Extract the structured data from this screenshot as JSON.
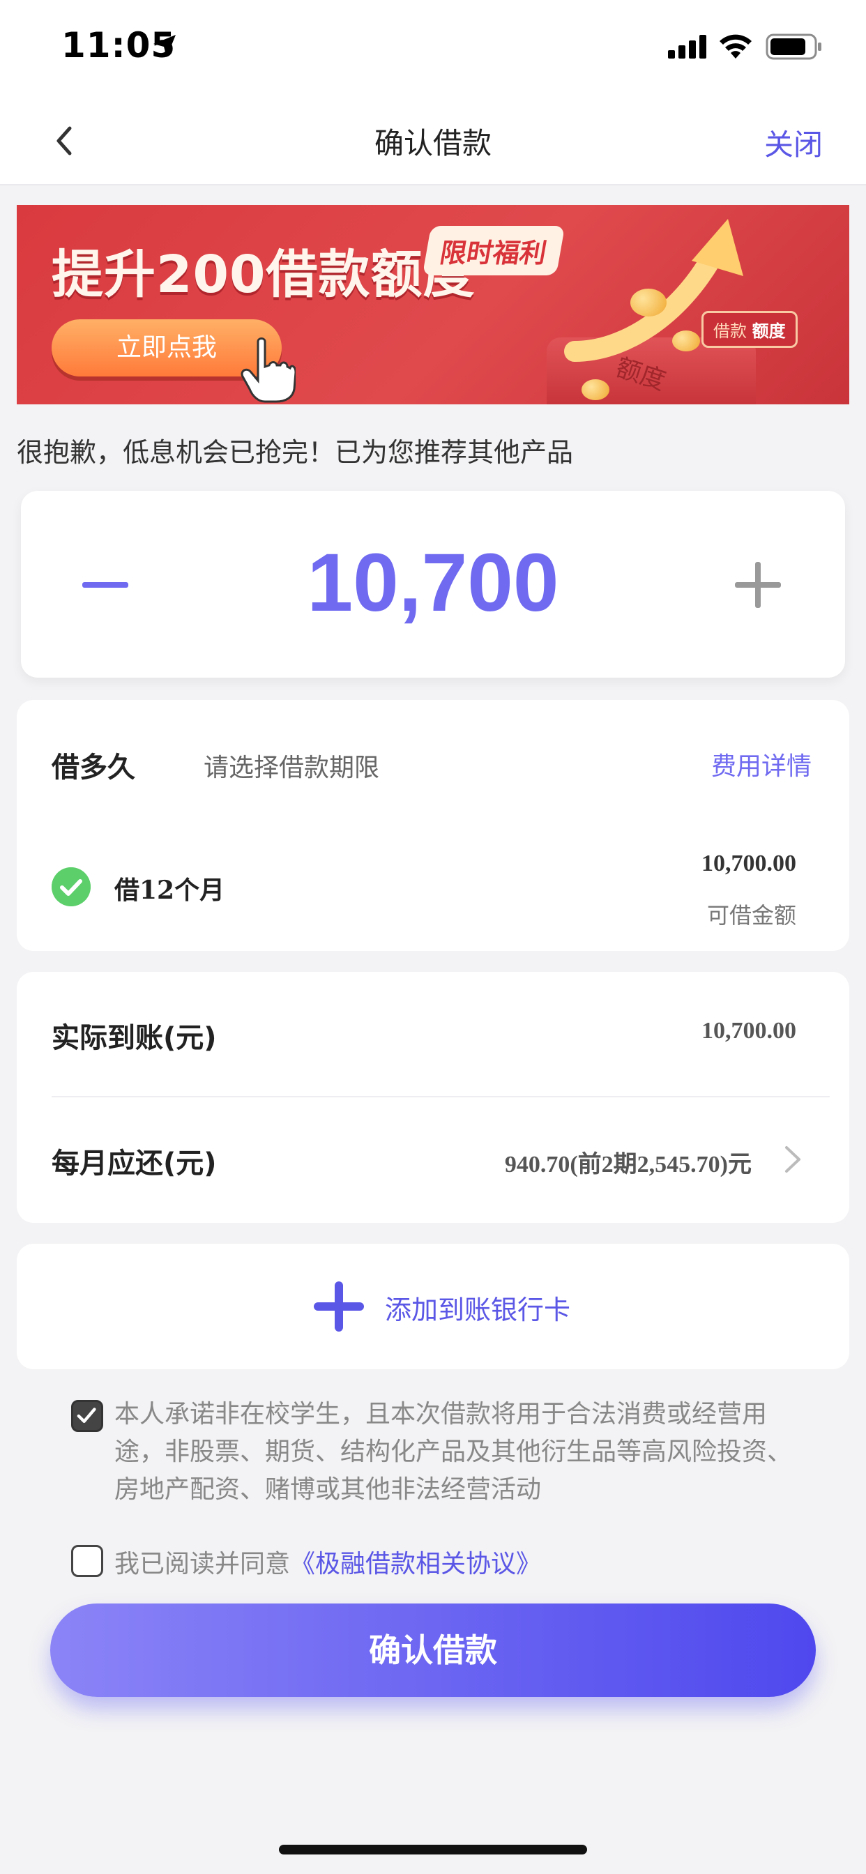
{
  "status_bar": {
    "time": "11:05",
    "icons": [
      "location-arrow-icon",
      "cellular-signal-icon",
      "wifi-icon",
      "battery-icon"
    ]
  },
  "nav": {
    "title": "确认借款",
    "close_label": "关闭",
    "back_icon": "chevron-left-icon"
  },
  "banner": {
    "title": "提升200借款额度",
    "badge": "限时福利",
    "cta": "立即点我",
    "tag_prefix": "借款",
    "tag_highlight": "额度",
    "stand_text": "额度"
  },
  "notice": "很抱歉，低息机会已抢完！已为您推荐其他产品",
  "amount": {
    "value": "10,700",
    "minus_icon": "minus-icon",
    "plus_icon": "plus-icon"
  },
  "term": {
    "label": "借多久",
    "hint": "请选择借款期限",
    "fee_link": "费用详情",
    "option_label": "借12个月",
    "option_amount": "10,700.00",
    "option_amount_label": "可借金额"
  },
  "summary": {
    "received_label": "实际到账(元)",
    "received_value": "10,700.00",
    "monthly_label": "每月应还(元)",
    "monthly_value": "940.70(前2期2,545.70)元"
  },
  "bank": {
    "add_label": "添加到账银行卡"
  },
  "agreements": {
    "pledge_checked": true,
    "pledge_text": "本人承诺非在校学生，且本次借款将用于合法消费或经营用途，非股票、期货、结构化产品及其他衍生品等高风险投资、房地产配资、赌博或其他非法经营活动",
    "agree_checked": false,
    "agree_prefix": "我已阅读并同意",
    "agree_link": "《极融借款相关协议》"
  },
  "confirm_button": "确认借款",
  "colors": {
    "accent": "#6f6af0",
    "link": "#5b57e6",
    "success": "#5ccf6a",
    "banner_red": "#d93a3f"
  }
}
